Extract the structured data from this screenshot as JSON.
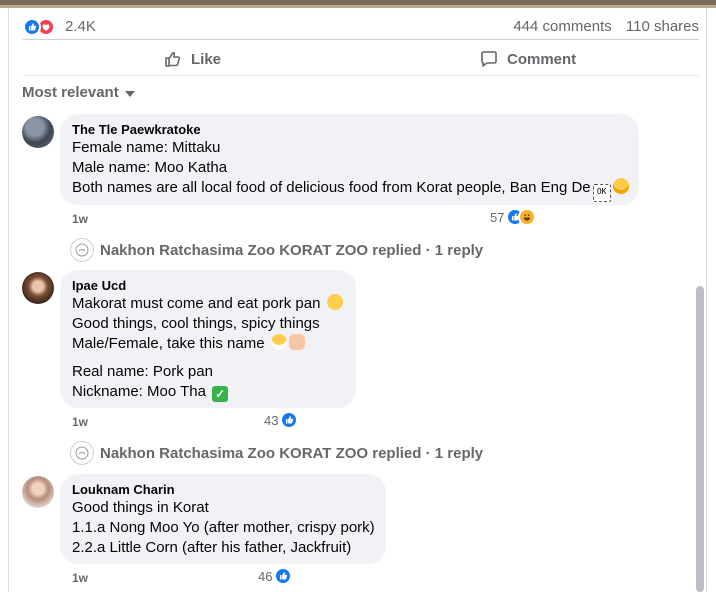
{
  "stats": {
    "reaction_count": "2.4K",
    "comments": "444 comments",
    "shares": "110 shares"
  },
  "actions": {
    "like": "Like",
    "comment": "Comment"
  },
  "filter": {
    "label": "Most relevant"
  },
  "comments": [
    {
      "name": "The Tle Paewkratoke",
      "lines": [
        "Female name: Mittaku",
        "Male name: Moo Katha",
        "Both names are all local food of delicious food from Korat people, Ban Eng De"
      ],
      "time": "1w",
      "reactions": "57",
      "reply_line": "Nakhon Ratchasima Zoo KORAT ZOO replied",
      "reply_count": "1 reply"
    },
    {
      "name": "Ipae Ucd",
      "lines": [
        "Makorat must come and eat pork pan",
        "Good things, cool things, spicy things",
        "Male/Female, take this name",
        "Real name: Pork pan",
        "Nickname: Moo Tha"
      ],
      "time": "1w",
      "reactions": "43",
      "reply_line": "Nakhon Ratchasima Zoo KORAT ZOO replied",
      "reply_count": "1 reply"
    },
    {
      "name": "Louknam Charin",
      "lines": [
        "Good things in Korat",
        "1.1.a Nong Moo Yo (after mother, crispy pork)",
        "2.2.a Little Corn (after his father, Jackfruit)"
      ],
      "time": "1w",
      "reactions": "46"
    }
  ],
  "colors": {
    "like_blue": "#1877f2",
    "love_red": "#f33e58",
    "bubble_bg": "#f0f2f5",
    "muted_text": "#65676b"
  }
}
